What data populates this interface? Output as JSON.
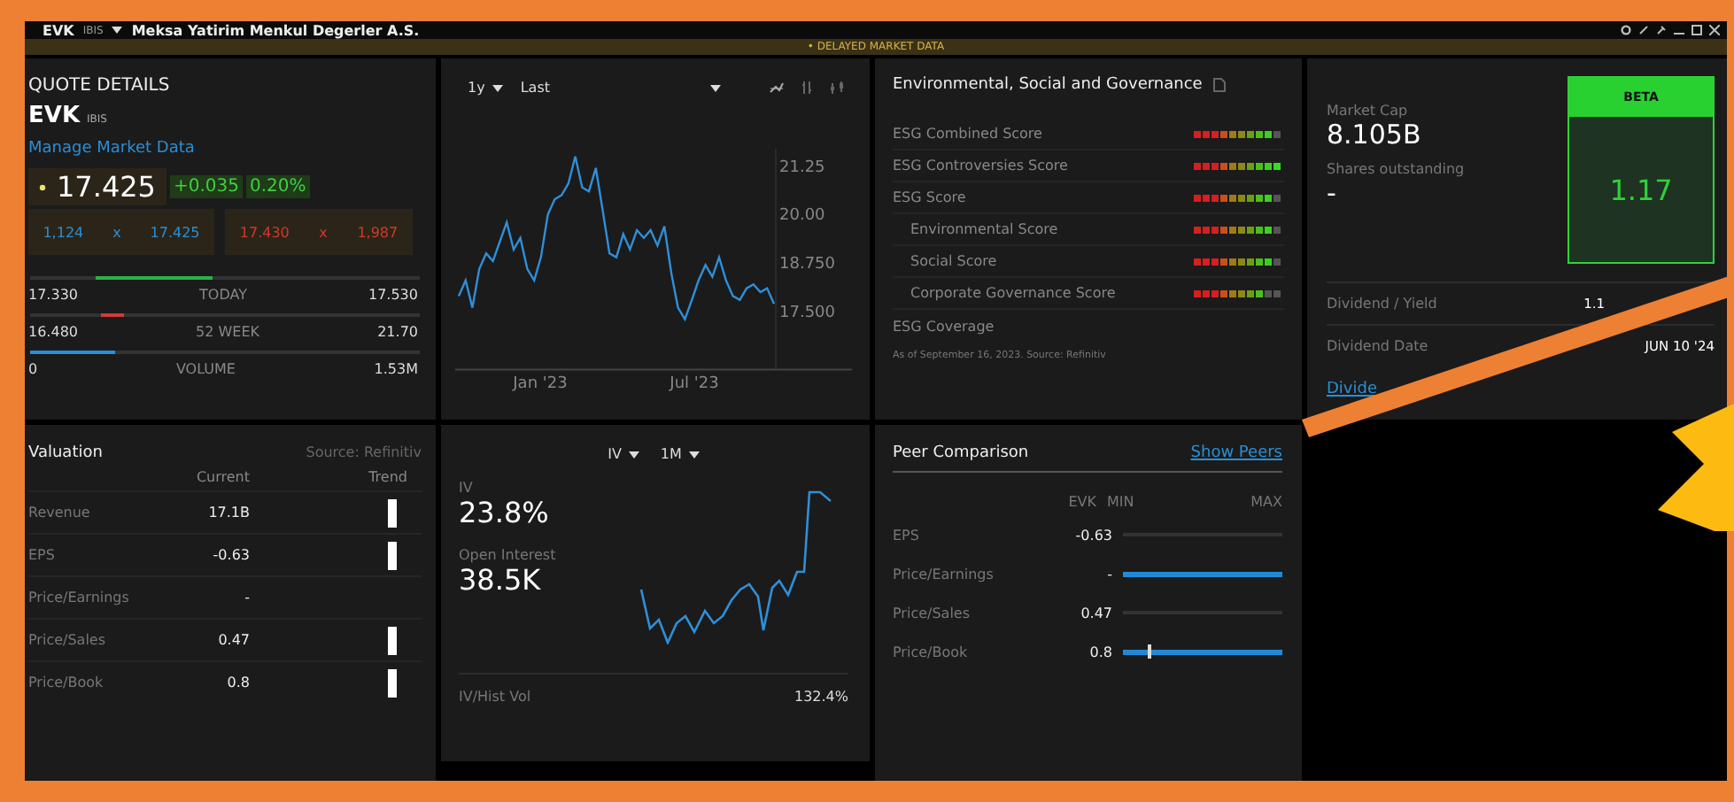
{
  "window": {
    "symbol": "EVK",
    "exchange": "IBIS",
    "company": "Meksa Yatirim Menkul Degerler A.S."
  },
  "notice": "• DELAYED MARKET DATA",
  "quote": {
    "title": "QUOTE DETAILS",
    "symbol": "EVK",
    "exchange": "IBIS",
    "link": "Manage Market Data",
    "price": "17.425",
    "change": "+0.035",
    "change_pct": "0.20%",
    "bid_size": "1,124",
    "bid_separator": "x",
    "bid": "17.425",
    "ask": "17.430",
    "ask_separator": "x",
    "ask_size": "1,987",
    "stats": [
      {
        "kind": "range",
        "level": 0.32,
        "low": "17.330",
        "label": "TODAY",
        "high": "17.530"
      },
      {
        "kind": "marker",
        "level": 0.21,
        "low": "16.480",
        "label": "52 WEEK",
        "high": "21.70"
      },
      {
        "kind": "fill",
        "level": 0.22,
        "low": "0",
        "label": "VOLUME",
        "high": "1.53M"
      }
    ]
  },
  "price_chart": {
    "period": "1y",
    "axis_labels": [
      "Jan '23",
      "Jul '23"
    ],
    "chart_data": {
      "type": "line",
      "series": [
        {
          "name": "Last",
          "color": "#2f8fd8",
          "values": [
            17.9,
            18.3,
            17.6,
            18.6,
            19.0,
            18.8,
            19.3,
            19.8,
            19.1,
            19.4,
            18.6,
            18.3,
            18.9,
            20.0,
            20.4,
            20.5,
            20.8,
            21.5,
            20.7,
            20.6,
            21.2,
            20.1,
            19.0,
            18.9,
            19.5,
            19.1,
            19.6,
            19.4,
            19.6,
            19.2,
            19.7,
            18.5,
            17.6,
            17.3,
            17.8,
            18.3,
            18.7,
            18.4,
            18.9,
            18.3,
            17.9,
            17.8,
            18.1,
            18.2,
            18.0,
            18.1,
            17.7
          ]
        }
      ],
      "yticks": [
        {
          "value": 17.5,
          "label": "17.500"
        },
        {
          "value": 18.75,
          "label": "18.750"
        },
        {
          "value": 20,
          "label": "20.00"
        },
        {
          "value": 21.25,
          "label": "21.25"
        }
      ],
      "ylim": [
        16,
        21.7
      ]
    }
  },
  "esg": {
    "title": "Environmental, Social and Governance",
    "rows": [
      {
        "label": "ESG Combined Score",
        "sub": false,
        "level": 0.9
      },
      {
        "label": "ESG Controversies Score",
        "sub": false,
        "level": 1
      },
      {
        "label": "ESG Score",
        "sub": false,
        "level": 0.9
      },
      {
        "label": "Environmental Score",
        "sub": true,
        "level": 0.9
      },
      {
        "label": "Social Score",
        "sub": true,
        "level": 0.9
      },
      {
        "label": "Corporate Governance Score",
        "sub": true,
        "level": 0.8
      }
    ],
    "coverage": "ESG Coverage",
    "note": "As of September 16, 2023. Source: Refinitiv"
  },
  "market": {
    "market_cap_label": "Market Cap",
    "market_cap": "8.105B",
    "shares_label": "Shares outstanding",
    "shares": "-",
    "beta_label": "BETA",
    "beta": "1.17",
    "rows": [
      {
        "label": "Dividend / Yield",
        "value": "1.1"
      },
      {
        "label": "Dividend Date",
        "value": "JUN 10 '24"
      }
    ],
    "link": "Divide"
  },
  "valuation": {
    "title": "Valuation",
    "source": "Source: Refinitiv",
    "columns": [
      "Current",
      "Trend"
    ],
    "rows": [
      {
        "label": "Revenue",
        "value": "17.1B",
        "trend": true
      },
      {
        "label": "EPS",
        "value": "-0.63",
        "trend": true
      },
      {
        "label": "Price/Earnings",
        "value": "-",
        "trend": false
      },
      {
        "label": "Price/Sales",
        "value": "0.47",
        "trend": true
      },
      {
        "label": "Price/Book",
        "value": "0.8",
        "trend": true
      }
    ]
  },
  "options": {
    "measure": "IV",
    "period": "1M",
    "iv_label": "IV",
    "iv": "23.8%",
    "oi_label": "Open Interest",
    "oi": "38.5K",
    "ratio_label": "IV/Hist Vol",
    "ratio": "132.4%"
  },
  "peers": {
    "title": "Peer Comparison",
    "link": "Show Peers",
    "columns": [
      "EVK",
      "MIN",
      "MAX"
    ],
    "rows": [
      {
        "label": "EPS",
        "value": "-0.63",
        "kind": "track",
        "filled": false
      },
      {
        "label": "Price/Earnings",
        "value": "-",
        "kind": "track",
        "filled": true
      },
      {
        "label": "Price/Sales",
        "value": "0.47",
        "kind": "track",
        "filled": false
      },
      {
        "label": "Price/Book",
        "value": "0.8",
        "kind": "marker",
        "filled": true,
        "level": 0.16
      }
    ]
  }
}
